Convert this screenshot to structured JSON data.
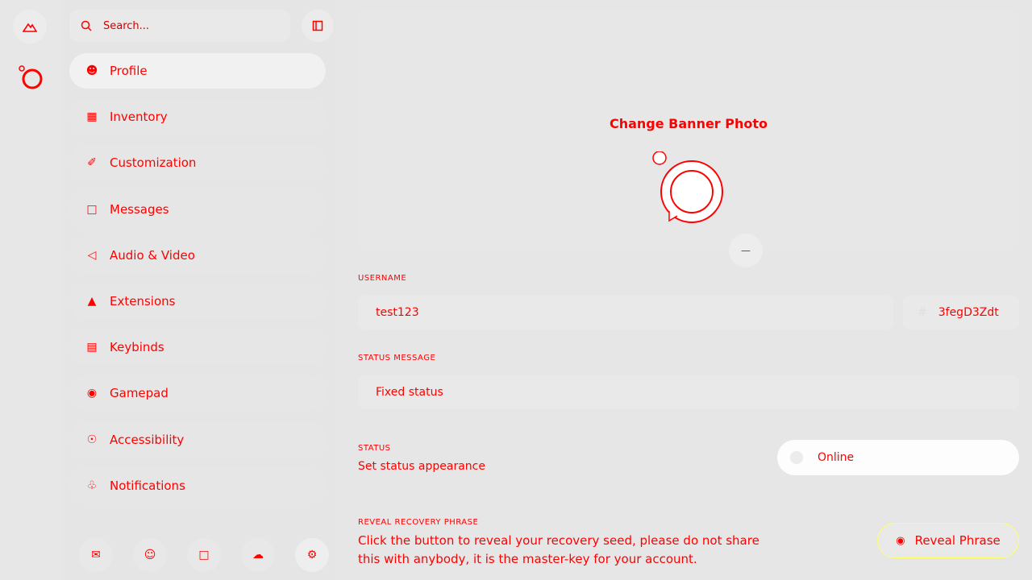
{
  "sidebar": {
    "search_placeholder": "Search...",
    "menu": [
      {
        "label": "Profile",
        "icon": "user-icon",
        "active": true
      },
      {
        "label": "Inventory",
        "icon": "inventory-icon",
        "active": false
      },
      {
        "label": "Customization",
        "icon": "paintbrush-icon",
        "active": false
      },
      {
        "label": "Messages",
        "icon": "chat-icon",
        "active": false
      },
      {
        "label": "Audio & Video",
        "icon": "speaker-icon",
        "active": false
      },
      {
        "label": "Extensions",
        "icon": "flask-icon",
        "active": false
      },
      {
        "label": "Keybinds",
        "icon": "keyboard-icon",
        "active": false
      },
      {
        "label": "Gamepad",
        "icon": "gamepad-icon",
        "active": false
      },
      {
        "label": "Accessibility",
        "icon": "accessibility-icon",
        "active": false
      },
      {
        "label": "Notifications",
        "icon": "bell-icon",
        "active": false
      }
    ],
    "footer_icons": [
      "mail-icon",
      "users-icon",
      "message-icon",
      "files-icon",
      "settings-icon"
    ]
  },
  "profile": {
    "banner_label": "Change Banner Photo",
    "username_label": "USERNAME",
    "username_value": "test123",
    "discriminator_value": "3fegD3Zdt",
    "status_message_label": "STATUS MESSAGE",
    "status_message_placeholder": "Fixed status",
    "status_label": "STATUS",
    "status_desc": "Set status appearance",
    "status_value": "Online",
    "recovery_label": "REVEAL RECOVERY PHRASE",
    "recovery_desc": "Click the button to reveal your recovery seed, please do not share this with anybody, it is the master-key for your account.",
    "reveal_button": "Reveal Phrase"
  },
  "colors": {
    "background": "#e6e6e6",
    "text": "#ff0000",
    "panel": "#f1f1f1",
    "accent_border": "#ffff66"
  }
}
